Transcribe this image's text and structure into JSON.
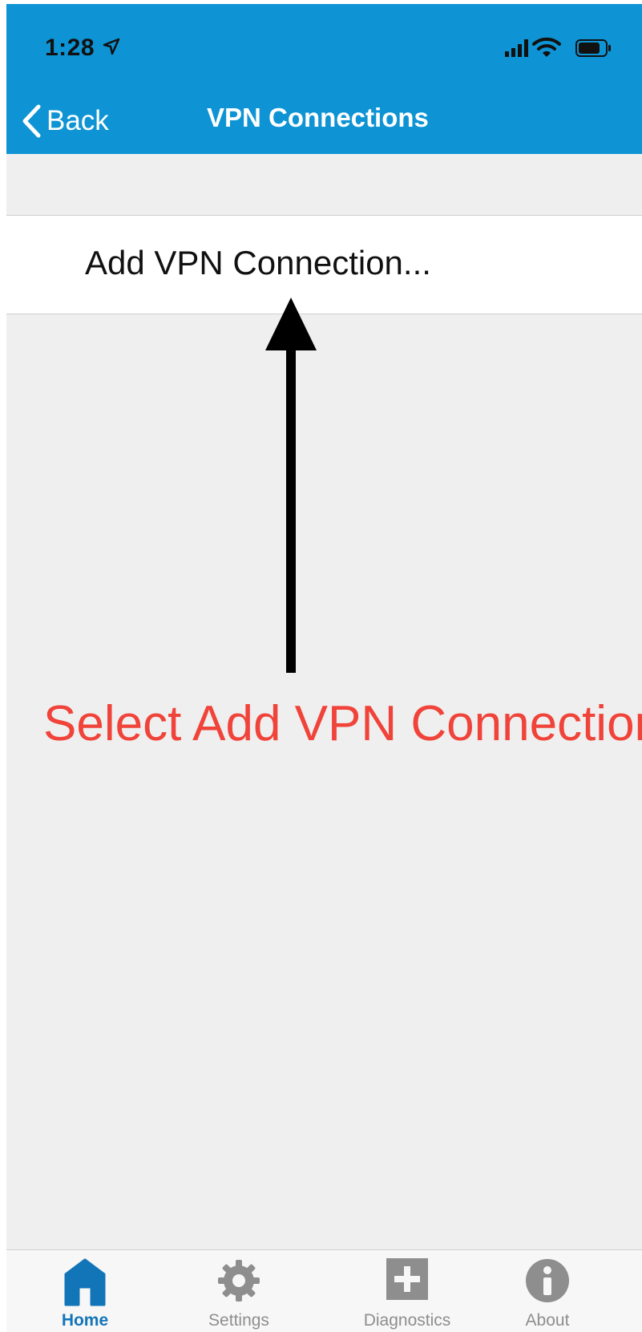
{
  "status_bar": {
    "time": "1:28"
  },
  "nav": {
    "back_label": "Back",
    "title": "VPN Connections"
  },
  "list": {
    "items": [
      {
        "label": "Add VPN Connection..."
      }
    ]
  },
  "annotation": {
    "text": "Select Add VPN Connection"
  },
  "tabbar": {
    "items": [
      {
        "label": "Home",
        "icon": "home-icon",
        "active": true
      },
      {
        "label": "Settings",
        "icon": "gear-icon",
        "active": false
      },
      {
        "label": "Diagnostics",
        "icon": "plus-square-icon",
        "active": false
      },
      {
        "label": "About",
        "icon": "info-icon",
        "active": false
      }
    ]
  },
  "colors": {
    "header_bg": "#0e94d4",
    "annotation": "#f0433a",
    "tab_active": "#1275b8",
    "tab_inactive": "#8e8e8e"
  }
}
